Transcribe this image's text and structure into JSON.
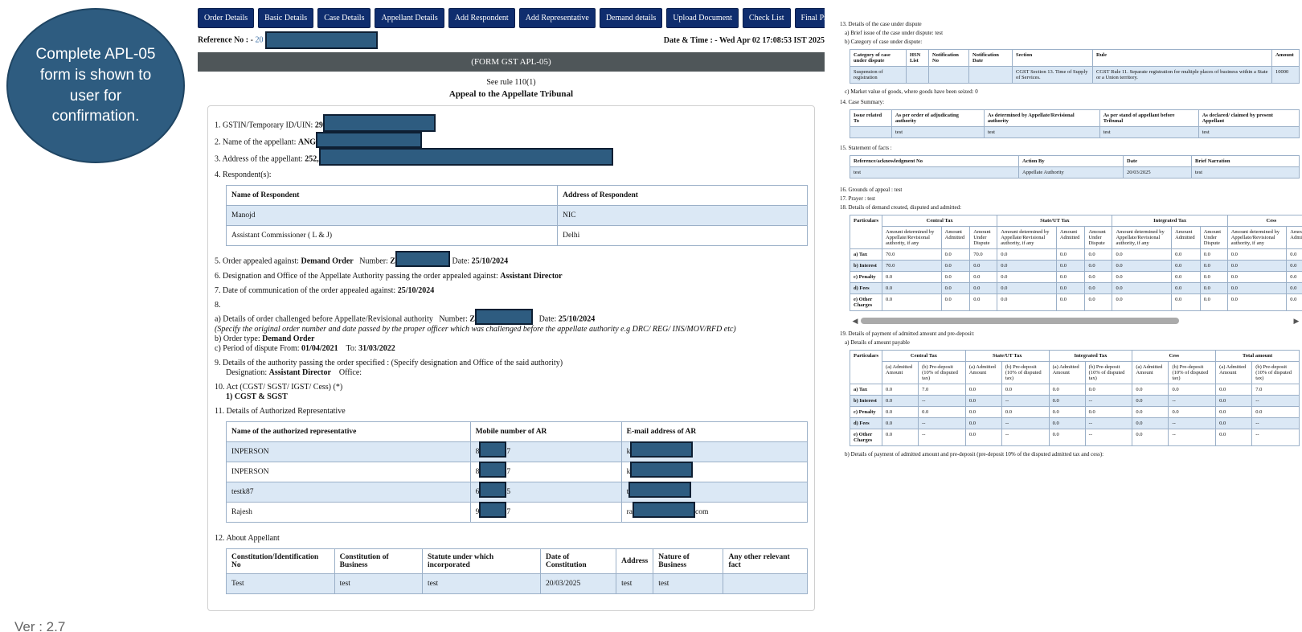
{
  "callout": {
    "text": "Complete APL-05 form is shown to user for confirmation."
  },
  "version": "Ver : 2.7",
  "tabs": [
    "Order Details",
    "Basic Details",
    "Case Details",
    "Appellant Details",
    "Add Respondent",
    "Add Representative",
    "Demand details",
    "Upload Document",
    "Check List",
    "Final Preview"
  ],
  "reference": {
    "label": "Reference No : -",
    "value": "20"
  },
  "datetime": "Date & Time : - Wed Apr 02 17:08:53 IST 2025",
  "form_header": "(FORM GST APL-05)",
  "see_rule": "See rule 110(1)",
  "appeal_title": "Appeal to the Appellate Tribunal",
  "f1": {
    "label": "1. GSTIN/Temporary ID/UIN:",
    "value": "29"
  },
  "f2": {
    "label": "2. Name of the appellant:",
    "value": "ANG"
  },
  "f3": {
    "label": "3. Address of the appellant:",
    "value": "252,"
  },
  "f4": {
    "label": "4. Respondent(s):"
  },
  "respondents": {
    "headers": [
      "Name of Respondent",
      "Address of Respondent"
    ],
    "rows": [
      [
        "Manojd",
        "NIC"
      ],
      [
        "Assistant Commissioner ( L & J)",
        "Delhi"
      ]
    ]
  },
  "f5": {
    "label": "5. Order appealed against:",
    "value": "Demand Order",
    "number_label": "Number:",
    "number_value": "Z",
    "date_label": "Date:",
    "date_value": "25/10/2024"
  },
  "f6": {
    "label": "6. Designation and Office of the Appellate Authority passing the order appealed against:",
    "value": "Assistant Director"
  },
  "f7": {
    "label": "7. Date of communication of the order appealed against:",
    "value": "25/10/2024"
  },
  "f8": {
    "label": "8.",
    "a_label": "a) Details of order challenged before Appellate/Revisional authority",
    "a_number_label": "Number:",
    "a_number_value": "Z",
    "a_date_label": "Date:",
    "a_date_value": "25/10/2024",
    "note": "(Specify the original order number and date passed by the proper officer which was challenged before the appellate authority e.g DRC/ REG/ INS/MOV/RFD etc)",
    "b_label": "b) Order type:",
    "b_value": "Demand Order",
    "c_label": "c) Period of dispute From:",
    "c_from": "01/04/2021",
    "c_to_label": "To:",
    "c_to": "31/03/2022"
  },
  "f9": {
    "label": "9. Details of the authority passing the order specified : (Specify designation and Office of the said authority)",
    "des_label": "Designation:",
    "des_value": "Assistant Director",
    "office_label": "Office:"
  },
  "f10": {
    "label": "10. Act (CGST/ SGST/ IGST/ Cess) (*)",
    "value": "1) CGST & SGST"
  },
  "f11": {
    "label": "11. Details of Authorized Representative"
  },
  "reps": {
    "headers": [
      "Name of the authorized representative",
      "Mobile number of AR",
      "E-mail address of AR"
    ],
    "rows": [
      {
        "name": "INPERSON",
        "mobile": "8",
        "mobile_end": "7",
        "email": "k",
        "email_end": ""
      },
      {
        "name": "INPERSON",
        "mobile": "8",
        "mobile_end": "7",
        "email": "k",
        "email_end": ""
      },
      {
        "name": "testk87",
        "mobile": "6",
        "mobile_end": "5",
        "email": "t",
        "email_end": ""
      },
      {
        "name": "Rajesh",
        "mobile": "9",
        "mobile_end": "7",
        "email": "ra",
        "email_end": "com"
      }
    ]
  },
  "f12": {
    "label": "12. About Appellant"
  },
  "about": {
    "headers": [
      "Constitution/Identification No",
      "Constitution of Business",
      "Statute under which incorporated",
      "Date of Constitution",
      "Address",
      "Nature of Business",
      "Any other relevant fact"
    ],
    "rows": [
      [
        "Test",
        "test",
        "test",
        "20/03/2025",
        "test",
        "test",
        ""
      ]
    ]
  },
  "r13": {
    "label": "13. Details of the case under dispute",
    "a": "a) Brief issue of the case under dispute: test",
    "b": "b) Category of case under dispute:",
    "headers": [
      "Category of case under dispute",
      "HSN List",
      "Notification No",
      "Notification Date",
      "Section",
      "Rule",
      "Amount"
    ],
    "rows": [
      [
        "Suspension of registration",
        "",
        "",
        "",
        "CGST Section 13. Time of Supply of Services.",
        "CGST Rule 11. Separate registration for multiple places of business within a State or a Union territory.",
        "10000"
      ]
    ],
    "c": "c) Market value of goods, where goods have been seized: 0"
  },
  "r14": {
    "label": "14. Case Summary:",
    "headers": [
      "Issue related To",
      "As per order of adjudicating authority",
      "As determined by Appellate/Revisional authority",
      "As per stand of appellant before Tribunal",
      "As declared/ claimed by present Appellant"
    ],
    "rows": [
      [
        "",
        "test",
        "test",
        "test",
        "test"
      ]
    ]
  },
  "r15": {
    "label": "15. Statement of facts :",
    "headers": [
      "Reference/acknowledgment No",
      "Action By",
      "Date",
      "Brief Narration"
    ],
    "rows": [
      [
        "test",
        "Appellate Authority",
        "20/03/2025",
        "test"
      ]
    ]
  },
  "r16": "16. Grounds of appeal : test",
  "r17": "17. Prayer : test",
  "r18": {
    "label": "18. Details of demand created, disputed and admitted:",
    "particulars": "Particulars",
    "groups": [
      "Central Tax",
      "State/UT Tax",
      "Integrated Tax",
      "Cess"
    ],
    "subheaders": [
      "Amount determined by Appellate/Revisional authority, if any",
      "Amount Admitted",
      "Amount Under Dispute"
    ],
    "rows": [
      {
        "label": "a) Tax",
        "values": [
          "70.0",
          "0.0",
          "70.0",
          "0.0",
          "0.0",
          "0.0",
          "0.0",
          "0.0",
          "0.0",
          "0.0",
          "0.0"
        ]
      },
      {
        "label": "b) Interest",
        "values": [
          "70.0",
          "0.0",
          "0.0",
          "0.0",
          "0.0",
          "0.0",
          "0.0",
          "0.0",
          "0.0",
          "0.0",
          "0.0"
        ]
      },
      {
        "label": "c) Penalty",
        "values": [
          "0.0",
          "0.0",
          "0.0",
          "0.0",
          "0.0",
          "0.0",
          "0.0",
          "0.0",
          "0.0",
          "0.0",
          "0.0"
        ]
      },
      {
        "label": "d) Fees",
        "values": [
          "0.0",
          "0.0",
          "0.0",
          "0.0",
          "0.0",
          "0.0",
          "0.0",
          "0.0",
          "0.0",
          "0.0",
          "0.0"
        ]
      },
      {
        "label": "e) Other Charges",
        "values": [
          "0.0",
          "0.0",
          "0.0",
          "0.0",
          "0.0",
          "0.0",
          "0.0",
          "0.0",
          "0.0",
          "0.0",
          "0.0"
        ]
      }
    ]
  },
  "r19": {
    "label": "19. Details of payment of admitted amount and pre-deposit:",
    "a": "a) Details of amount payable",
    "particulars": "Particulars",
    "groups": [
      "Central Tax",
      "State/UT Tax",
      "Integrated Tax",
      "Cess",
      "Total amount"
    ],
    "subheaders": [
      "(a) Admitted Amount",
      "(b) Pre-deposit (10% of disputed tax)"
    ],
    "rows": [
      {
        "label": "a) Tax",
        "values": [
          "0.0",
          "7.0",
          "0.0",
          "0.0",
          "0.0",
          "0.0",
          "0.0",
          "0.0",
          "0.0",
          "7.0"
        ]
      },
      {
        "label": "b) Interest",
        "values": [
          "0.0",
          "--",
          "0.0",
          "--",
          "0.0",
          "--",
          "0.0",
          "--",
          "0.0",
          "--"
        ]
      },
      {
        "label": "c) Penalty",
        "values": [
          "0.0",
          "0.0",
          "0.0",
          "0.0",
          "0.0",
          "0.0",
          "0.0",
          "0.0",
          "0.0",
          "0.0"
        ]
      },
      {
        "label": "d) Fees",
        "values": [
          "0.0",
          "--",
          "0.0",
          "--",
          "0.0",
          "--",
          "0.0",
          "--",
          "0.0",
          "--"
        ]
      },
      {
        "label": "e) Other Charges",
        "values": [
          "0.0",
          "--",
          "0.0",
          "--",
          "0.0",
          "--",
          "0.0",
          "--",
          "0.0",
          "--"
        ]
      }
    ],
    "b": "b) Details of payment of admitted amount and pre-deposit (pre-deposit 10% of the disputed admitted tax and cess):"
  },
  "colors": {
    "tab_bg": "#0f2d6e",
    "form_bar": "#4f5659",
    "redaction": "#2e5c80",
    "row_alt": "#dbe8f5"
  }
}
